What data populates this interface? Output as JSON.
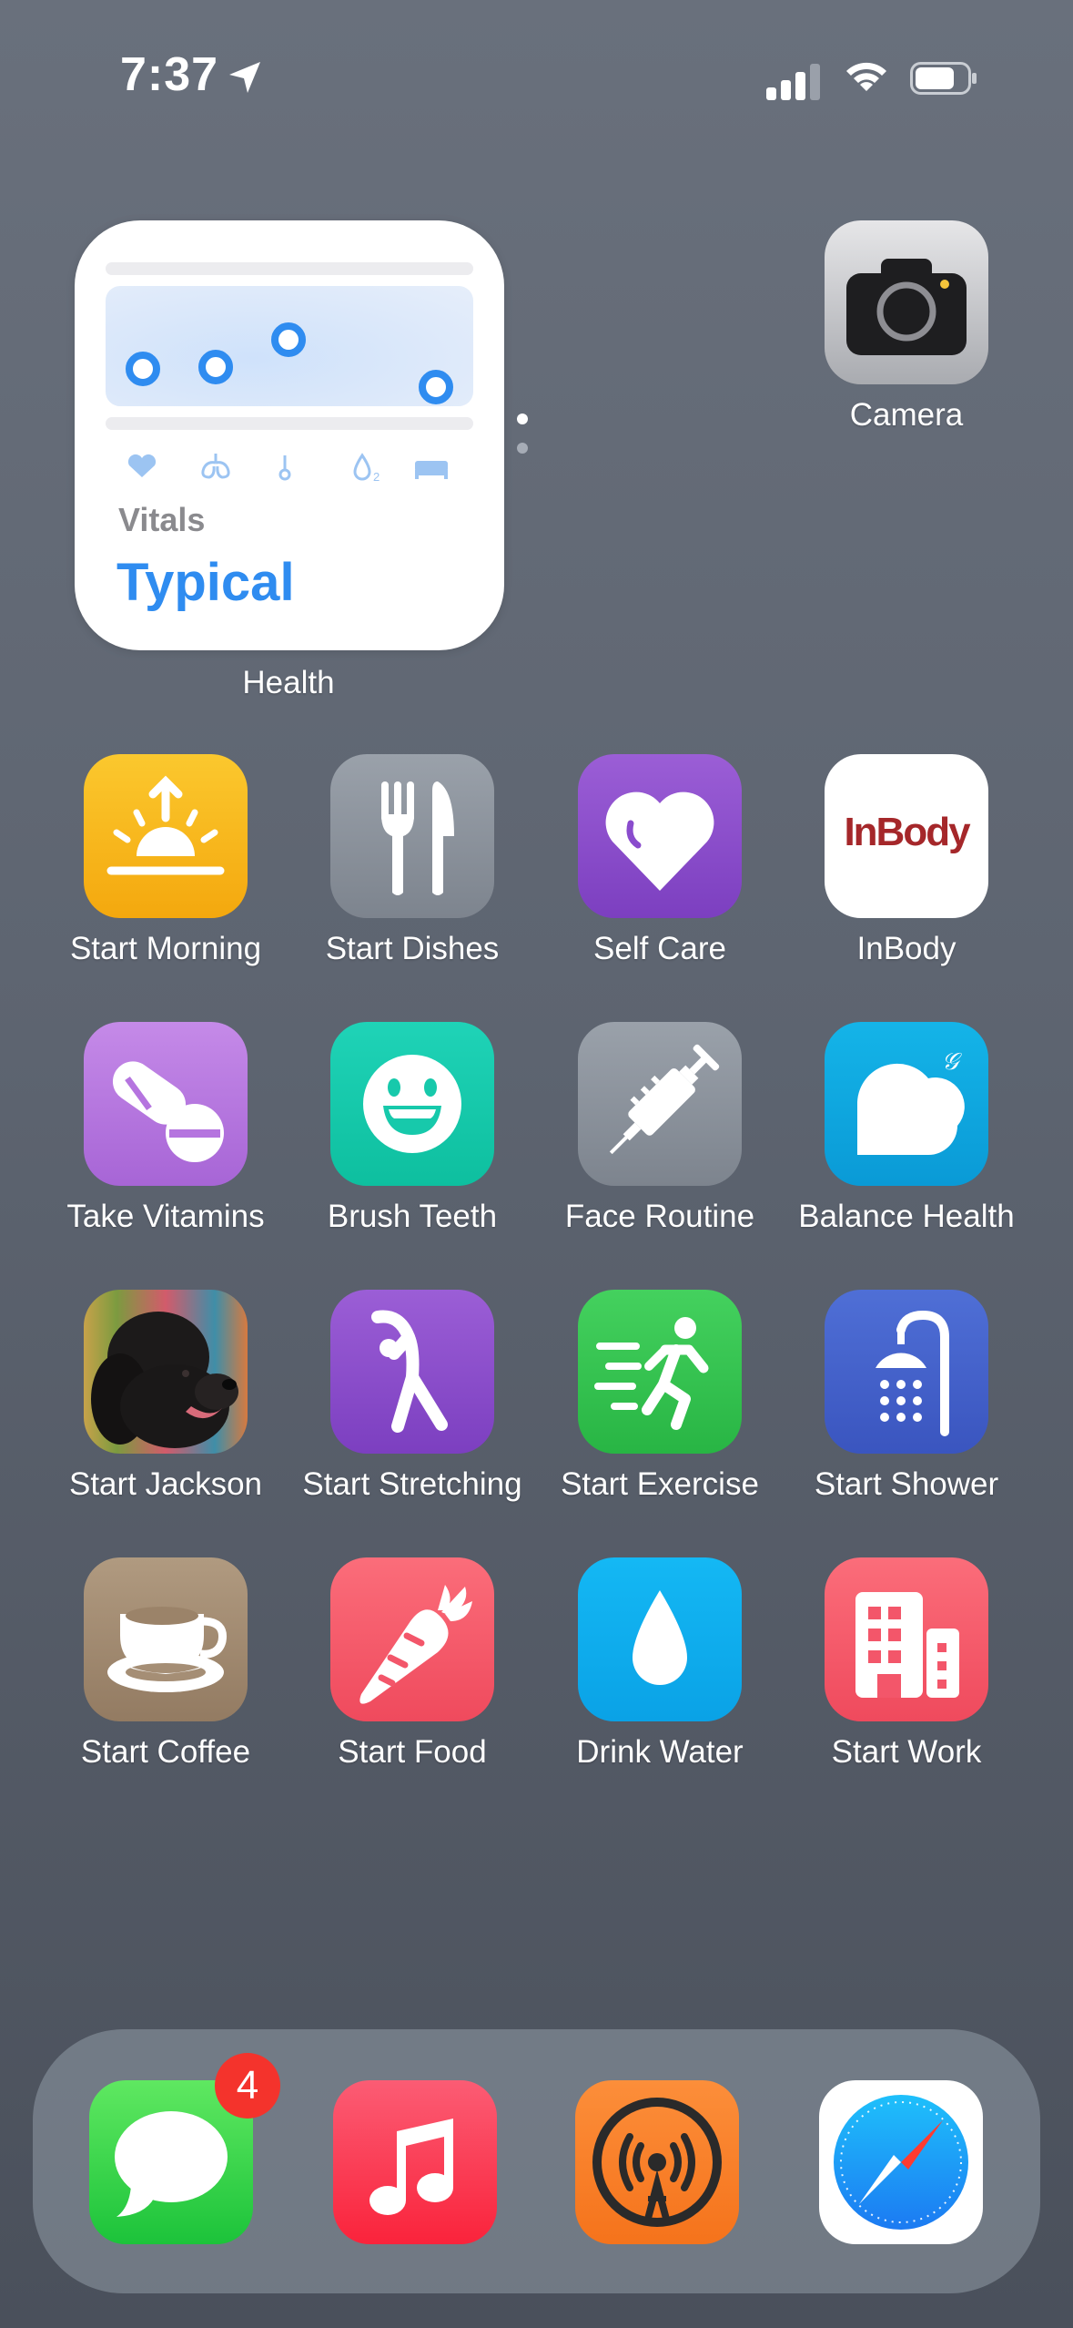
{
  "status_bar": {
    "time": "7:37"
  },
  "widget": {
    "app_label": "Health",
    "caption": "Vitals",
    "status": "Typical"
  },
  "apps": {
    "camera": "Camera",
    "start_morning": "Start Morning",
    "start_dishes": "Start Dishes",
    "self_care": "Self Care",
    "inbody": "InBody",
    "inbody_logo": "InBody",
    "take_vitamins": "Take Vitamins",
    "brush_teeth": "Brush Teeth",
    "face_routine": "Face Routine",
    "balance_health": "Balance Health",
    "start_jackson": "Start Jackson",
    "start_stretching": "Start Stretching",
    "start_exercise": "Start Exercise",
    "start_shower": "Start Shower",
    "start_coffee": "Start Coffee",
    "start_food": "Start Food",
    "drink_water": "Drink Water",
    "start_work": "Start Work"
  },
  "dock": {
    "messages_badge": "4"
  },
  "colors": {
    "health_blue": "#2f8cf0",
    "badge_red": "#f4332c"
  }
}
